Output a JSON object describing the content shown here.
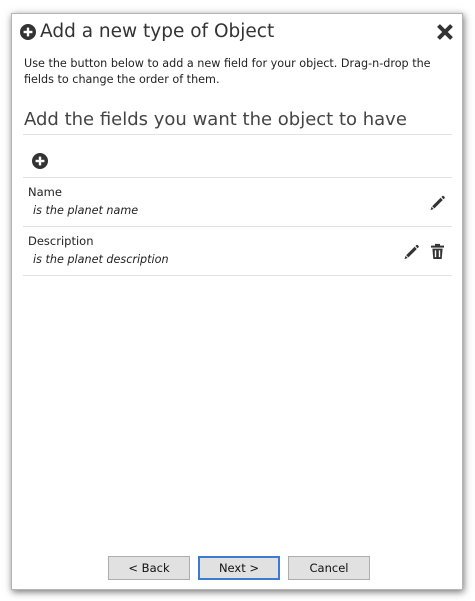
{
  "dialog": {
    "title": "Add a new type of Object",
    "intro": "Use the button below to add a new field for your object. Drag-n-drop the fields to change the order of them."
  },
  "fields_section": {
    "title": "Add the fields you want the object to have",
    "add_icon": "plus-circle-icon",
    "items": [
      {
        "name": "Name",
        "description": "is the planet name",
        "actions": [
          "pencil-icon"
        ]
      },
      {
        "name": "Description",
        "description": "is the planet description",
        "actions": [
          "pencil-icon",
          "trash-icon"
        ]
      }
    ]
  },
  "footer": {
    "back_label": "< Back",
    "next_label": "Next >",
    "cancel_label": "Cancel"
  },
  "colors": {
    "icon": "#333333",
    "text": "#222222",
    "divider": "#e2e2e2",
    "button_bg": "#e1e1e1",
    "button_border": "#adadad",
    "focus_border": "#3d7bd3"
  }
}
